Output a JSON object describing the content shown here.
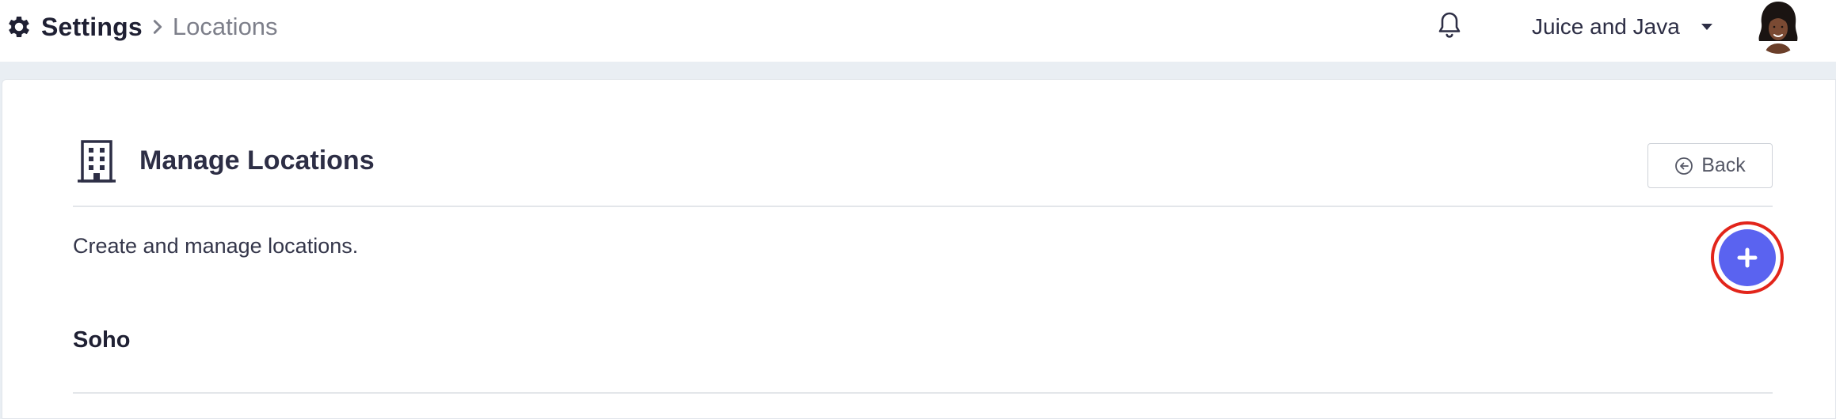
{
  "header": {
    "title": "Settings",
    "current_page": "Locations",
    "organization": "Juice and Java",
    "icons": {
      "settings": "gear-icon",
      "separator": "chevron-right-icon",
      "notifications": "bell-icon",
      "org_menu": "caret-down-icon",
      "user": "avatar"
    }
  },
  "main": {
    "title": "Manage Locations",
    "title_icon": "building-icon",
    "back_label": "Back",
    "back_icon": "arrow-left-circle-icon",
    "description": "Create and manage locations.",
    "add_icon": "plus-icon",
    "locations": [
      {
        "name": "Soho"
      }
    ]
  },
  "colors": {
    "accent": "#5a63f0",
    "highlight_ring": "#e2251b",
    "text_primary": "#2d2e45",
    "text_muted": "#7d7f8a",
    "page_background": "#e9eef3"
  }
}
